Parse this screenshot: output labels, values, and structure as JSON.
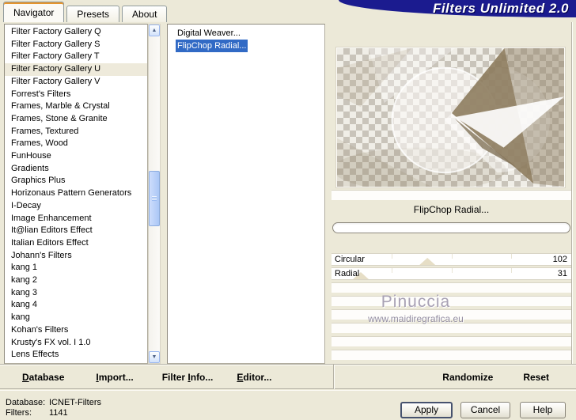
{
  "window": {
    "title": "Filters Unlimited 2.0"
  },
  "tabs": [
    {
      "label": "Navigator",
      "active": true
    },
    {
      "label": "Presets"
    },
    {
      "label": "About"
    }
  ],
  "category_list": {
    "items": [
      {
        "label": "Filter Factory Gallery Q"
      },
      {
        "label": "Filter Factory Gallery S"
      },
      {
        "label": "Filter Factory Gallery T"
      },
      {
        "label": "Filter Factory Gallery U",
        "selected": true
      },
      {
        "label": "Filter Factory Gallery V"
      },
      {
        "label": "Forrest's Filters"
      },
      {
        "label": "Frames, Marble & Crystal"
      },
      {
        "label": "Frames, Stone & Granite"
      },
      {
        "label": "Frames, Textured"
      },
      {
        "label": "Frames, Wood"
      },
      {
        "label": "FunHouse"
      },
      {
        "label": "Gradients"
      },
      {
        "label": "Graphics Plus"
      },
      {
        "label": "Horizonaus Pattern Generators"
      },
      {
        "label": "I-Decay"
      },
      {
        "label": "Image Enhancement"
      },
      {
        "label": "It@lian Editors Effect"
      },
      {
        "label": "Italian Editors Effect"
      },
      {
        "label": "Johann's Filters"
      },
      {
        "label": "kang 1"
      },
      {
        "label": "kang 2"
      },
      {
        "label": "kang 3"
      },
      {
        "label": "kang 4"
      },
      {
        "label": "kang"
      },
      {
        "label": "Kohan's Filters"
      },
      {
        "label": "Krusty's FX vol. I 1.0"
      },
      {
        "label": "Lens Effects"
      }
    ]
  },
  "filter_list": {
    "items": [
      {
        "label": "Digital Weaver..."
      },
      {
        "label": "FlipChop Radial...",
        "selected": true
      }
    ]
  },
  "right_panel": {
    "filter_name": "FlipChop Radial...",
    "sliders": [
      {
        "label": "Circular",
        "value": 102,
        "max": 255
      },
      {
        "label": "Radial",
        "value": 31,
        "max": 255
      }
    ],
    "watermark_line1": "Pinuccia",
    "watermark_line2": "www.maidiregrafica.eu"
  },
  "action_bar": {
    "buttons": [
      {
        "pre": "",
        "key": "D",
        "rest": "atabase"
      },
      {
        "pre": "",
        "key": "I",
        "rest": "mport..."
      },
      {
        "pre": "Filter ",
        "key": "I",
        "rest": "nfo..."
      },
      {
        "pre": "",
        "key": "E",
        "rest": "ditor..."
      }
    ],
    "randomize_label": "Randomize",
    "reset_label": "Reset"
  },
  "status": {
    "db_label": "Database:",
    "db_value": "ICNET-Filters",
    "filters_label": "Filters:",
    "filters_value": "1141"
  },
  "dialog_buttons": {
    "apply": "Apply",
    "cancel": "Cancel",
    "help": "Help"
  },
  "colors": {
    "title_bg": "#1b1b8f",
    "selection_blue": "#316ac5",
    "tab_accent": "#e5952e",
    "dialog_bg": "#ece9d8"
  }
}
